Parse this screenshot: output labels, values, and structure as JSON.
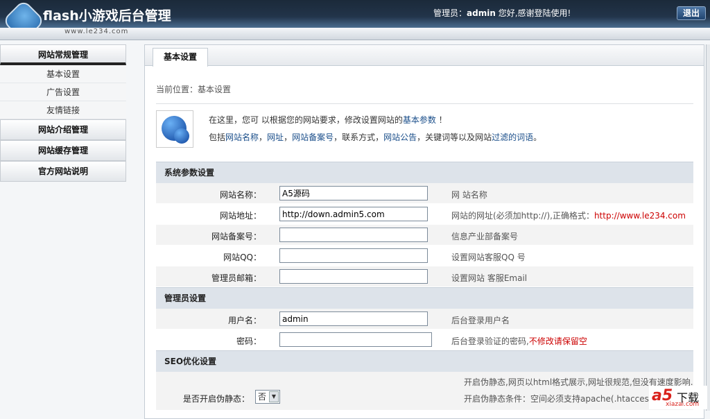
{
  "header": {
    "title": "flash小游戏后台管理",
    "site_url": "www.le234.com",
    "welcome_prefix": "管理员：",
    "admin_name": "admin",
    "welcome_suffix": " 您好,感谢登陆使用!",
    "logout_label": "退出"
  },
  "sidebar": {
    "groups": [
      {
        "label": "网站常规管理",
        "items": [
          "基本设置",
          "广告设置",
          "友情链接"
        ]
      },
      {
        "label": "网站介绍管理"
      },
      {
        "label": "网站缓存管理"
      },
      {
        "label": "官方网站说明"
      }
    ]
  },
  "main": {
    "tab": "基本设置",
    "breadcrumb": "当前位置：基本设置",
    "intro": {
      "l1_a": "在这里，您可 以根据您的网站要求，修改设置网站的",
      "l1_link": "基本参数",
      "l1_end": " ！",
      "l2": [
        "包括",
        "网站名称",
        "，",
        "网址",
        "，",
        "网站备案号",
        "，联系方式，",
        "网站公告",
        "，关键词等以及网站",
        "过滤的词语",
        "。"
      ]
    },
    "sections": {
      "system": {
        "title": "系统参数设置",
        "rows": [
          {
            "label": "网站名称：",
            "value": "A5源码",
            "hint": "网 站名称"
          },
          {
            "label": "网站地址：",
            "value": "http://down.admin5.com",
            "hint": "网站的网址(必须加http://),正确格式：",
            "hint_red": "http://www.le234.com"
          },
          {
            "label": "网站备案号：",
            "value": "",
            "hint": "信息产业部备案号"
          },
          {
            "label": "网站QQ：",
            "value": "",
            "hint": "设置网站客服QQ 号"
          },
          {
            "label": "管理员邮箱：",
            "value": "",
            "hint": "设置网站 客服Email"
          }
        ]
      },
      "admin": {
        "title": "管理员设置",
        "rows": [
          {
            "label": "用户名：",
            "value": "admin",
            "hint": "后台登录用户名"
          },
          {
            "label": "密码：",
            "value": "",
            "hint": "后台登录验证的密码,",
            "hint_red": "不修改请保留空"
          }
        ]
      },
      "seo": {
        "title": "SEO优化设置",
        "label": "是否开启伪静态：",
        "selected": "否",
        "hint1": "开启伪静态,网页以html格式展示,网址很规范,但没有速度影响.",
        "hint2": "开启伪静态条件：空间必须支持apache(.htaccess"
      }
    }
  },
  "watermark": {
    "a": "a5",
    "b": "下载",
    "c": "xiazai.com"
  }
}
